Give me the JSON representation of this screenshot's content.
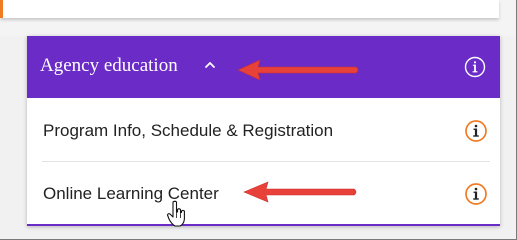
{
  "accordion": {
    "header": {
      "label": "Agency education",
      "expanded": true,
      "color": "#6a2bc6",
      "chevron_icon": "chevron-up-icon",
      "info_icon": "info-circle-icon"
    },
    "items": [
      {
        "label": "Program Info, Schedule & Registration",
        "info_icon": "info-circle-icon"
      },
      {
        "label": "Online Learning Center",
        "info_icon": "info-circle-icon"
      }
    ],
    "accent_color": "#f07b24"
  },
  "annotations": {
    "arrow_color": "#e8413a",
    "arrows": [
      "arrow-pointing-at-header",
      "arrow-pointing-at-online-learning-center"
    ]
  }
}
